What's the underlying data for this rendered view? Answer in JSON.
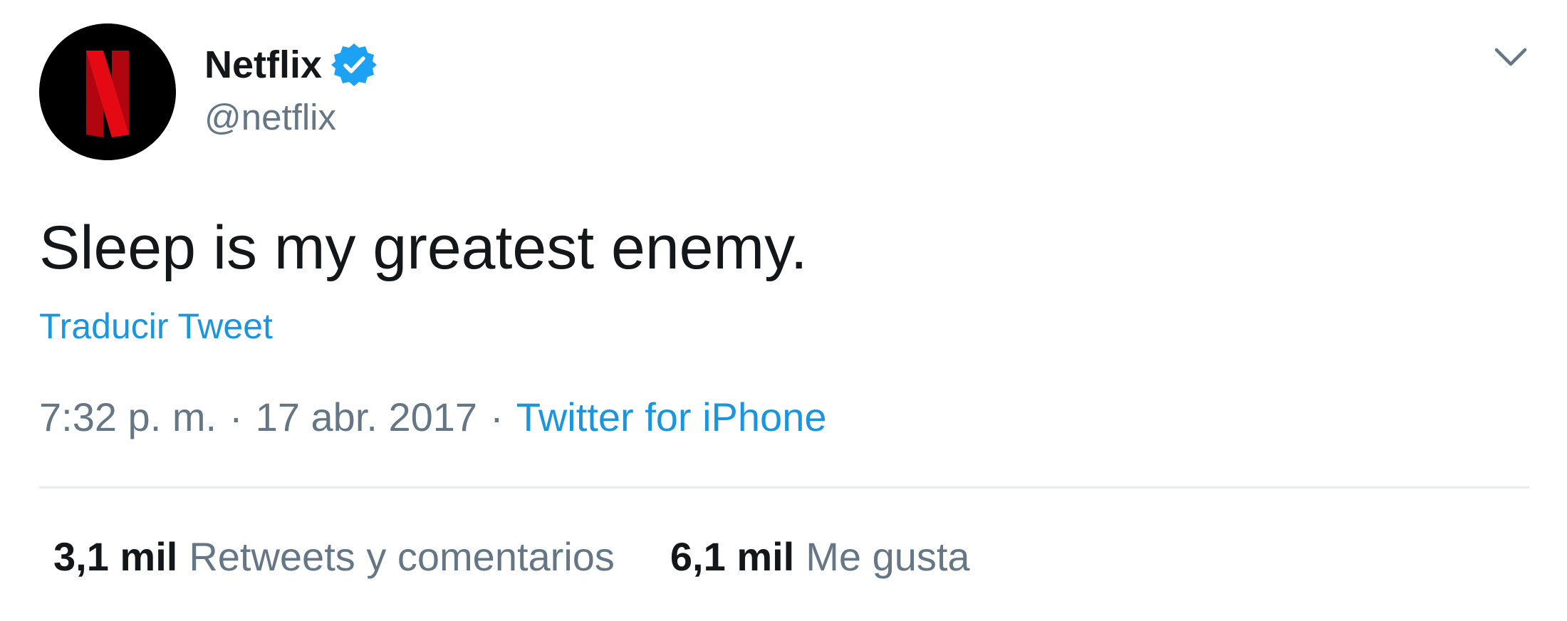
{
  "tweet": {
    "author": {
      "display_name": "Netflix",
      "handle": "@netflix",
      "verified": true,
      "avatar_icon": "netflix-n-logo"
    },
    "menu_icon": "chevron-down-icon",
    "text": "Sleep is my greatest enemy.",
    "translate_label": "Traducir Tweet",
    "time": "7:32 p. m.",
    "separator": "·",
    "date": "17 abr. 2017",
    "source": "Twitter for iPhone",
    "stats": [
      {
        "count": "3,1 mil",
        "label": "Retweets y comentarios"
      },
      {
        "count": "6,1 mil",
        "label": "Me gusta"
      }
    ]
  },
  "colors": {
    "text_primary": "#14171a",
    "text_secondary": "#657786",
    "accent": "#1b95e0",
    "verified_badge": "#1da1f2",
    "netflix_red": "#e50914",
    "divider": "#e6ecf0"
  }
}
